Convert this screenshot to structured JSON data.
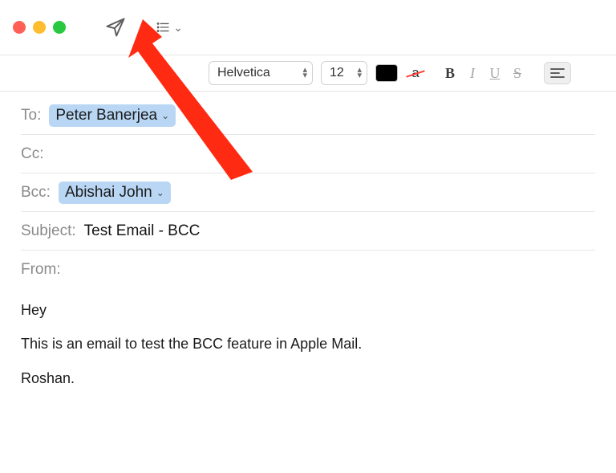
{
  "toolbar": {
    "send_icon": "paper-plane",
    "list_icon": "list-bullet",
    "font_family": "Helvetica",
    "font_size": "12",
    "text_color": "#000000",
    "bold": "B",
    "italic": "I",
    "underline": "U",
    "strike": "S",
    "char_a": "a"
  },
  "fields": {
    "to_label": "To:",
    "to_chip": "Peter Banerjea",
    "cc_label": "Cc:",
    "bcc_label": "Bcc:",
    "bcc_chip": "Abishai John",
    "subject_label": "Subject:",
    "subject_value": "Test Email - BCC",
    "from_label": "From:"
  },
  "body": {
    "line1": "Hey",
    "line2": "This is an email to test the BCC feature in Apple Mail.",
    "line3": "Roshan."
  },
  "annotation": {
    "arrow_color": "#ff2a12"
  }
}
